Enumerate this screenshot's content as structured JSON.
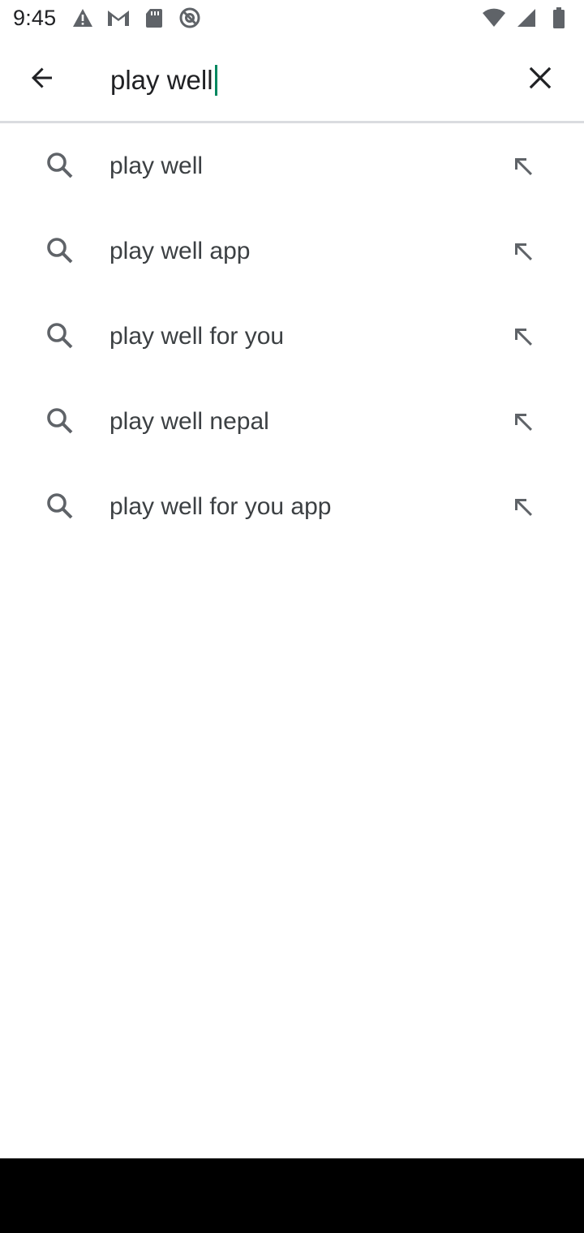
{
  "status_bar": {
    "time": "9:45",
    "left_icons": [
      "warning-icon",
      "gmail-icon",
      "sd-card-icon",
      "do-not-disturb-icon"
    ],
    "right_icons": [
      "wifi-icon",
      "signal-icon",
      "battery-icon"
    ]
  },
  "search": {
    "query": "play well",
    "back_icon": "arrow-back-icon",
    "clear_icon": "close-icon",
    "accent_color": "#01875f"
  },
  "suggestions": [
    {
      "label": "play well",
      "icon": "search-icon",
      "action_icon": "arrow-up-left-icon"
    },
    {
      "label": "play well app",
      "icon": "search-icon",
      "action_icon": "arrow-up-left-icon"
    },
    {
      "label": "play well for you",
      "icon": "search-icon",
      "action_icon": "arrow-up-left-icon"
    },
    {
      "label": "play well nepal",
      "icon": "search-icon",
      "action_icon": "arrow-up-left-icon"
    },
    {
      "label": "play well for you app",
      "icon": "search-icon",
      "action_icon": "arrow-up-left-icon"
    }
  ]
}
